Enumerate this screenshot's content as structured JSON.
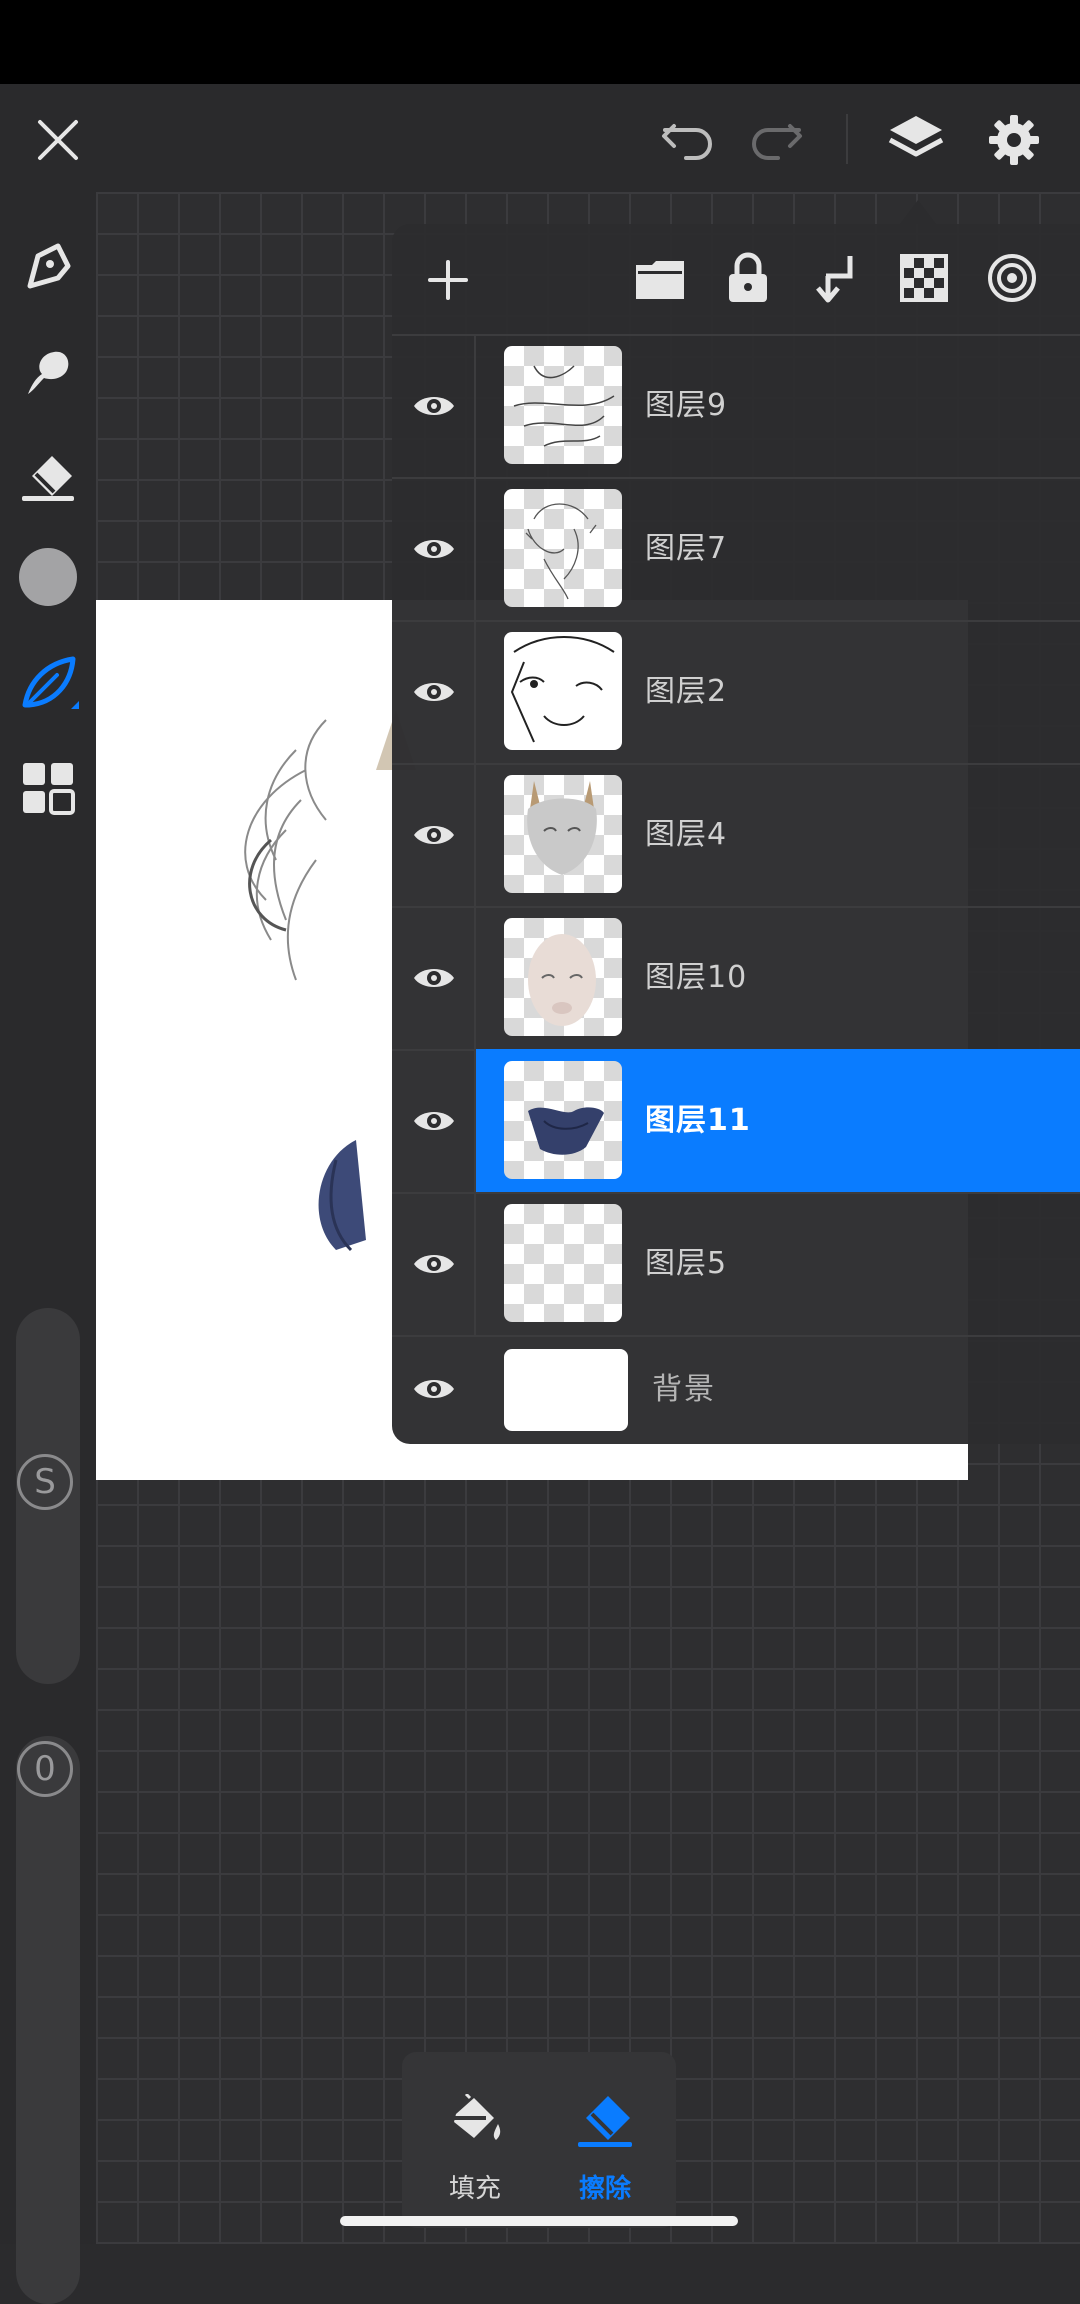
{
  "colors": {
    "accent": "#0a7cff",
    "panel": "#2c2c2e",
    "toolbar": "#2a2a2c",
    "icon": "#dddddd"
  },
  "topbar": {
    "icons": [
      "close-icon",
      "undo-icon",
      "redo-icon",
      "layers-icon",
      "settings-icon"
    ]
  },
  "left_toolbar": {
    "icons": [
      "pen-icon",
      "smudge-icon",
      "eraser-icon",
      "color-swatch",
      "leaf-brush-icon",
      "grid-apps-icon"
    ],
    "size_badge": "S",
    "opacity_badge": "0"
  },
  "layers_panel": {
    "toolbar_icons": [
      "add-layer-icon",
      "folder-icon",
      "lock-icon",
      "merge-down-icon",
      "alpha-lock-icon",
      "blend-icon"
    ],
    "layers": [
      {
        "name": "图层9",
        "visible": true,
        "selected": false
      },
      {
        "name": "图层7",
        "visible": true,
        "selected": false
      },
      {
        "name": "图层2",
        "visible": true,
        "selected": false
      },
      {
        "name": "图层4",
        "visible": true,
        "selected": false
      },
      {
        "name": "图层10",
        "visible": true,
        "selected": false
      },
      {
        "name": "图层11",
        "visible": true,
        "selected": true
      },
      {
        "name": "图层5",
        "visible": true,
        "selected": false
      }
    ],
    "background": {
      "name": "背景",
      "visible": true
    }
  },
  "bottom_popup": {
    "fill_label": "填充",
    "erase_label": "擦除",
    "active": "erase"
  }
}
